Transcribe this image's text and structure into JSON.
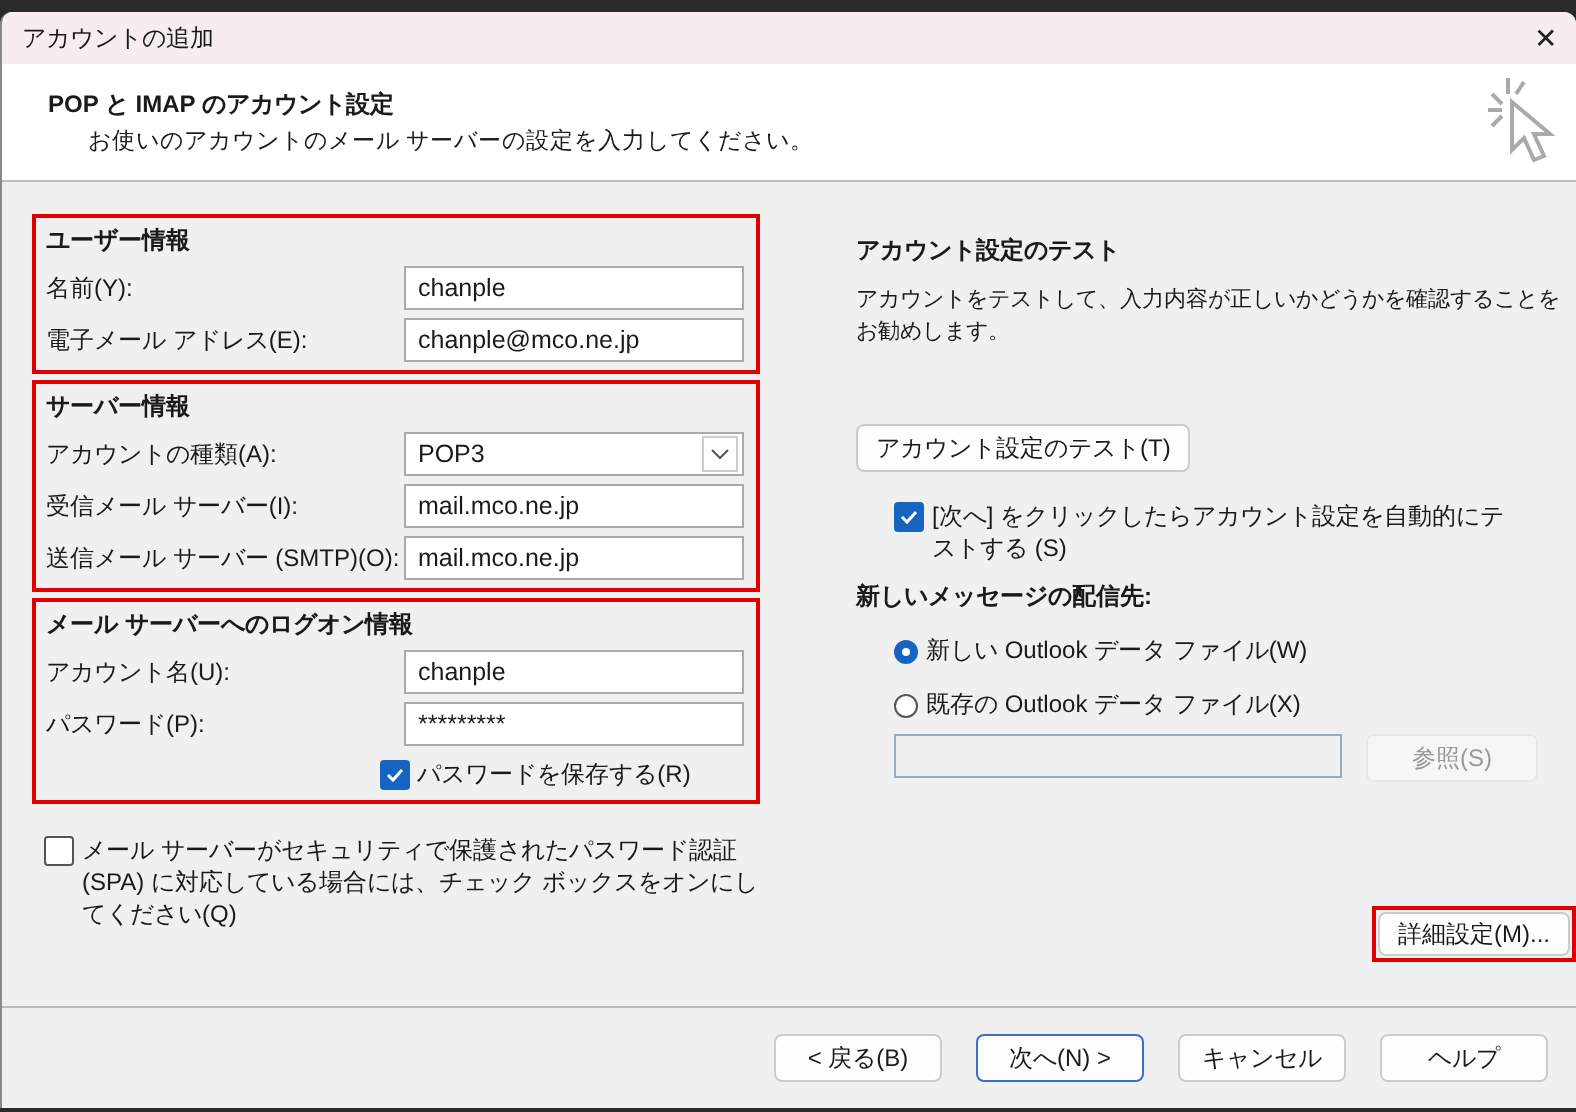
{
  "window": {
    "title": "アカウントの追加",
    "close": "✕"
  },
  "header": {
    "title": "POP と IMAP のアカウント設定",
    "subtitle": "お使いのアカウントのメール サーバーの設定を入力してください。"
  },
  "sections": [
    {
      "title": "ユーザー情報",
      "highlighted": true,
      "fields": [
        {
          "kind": "text",
          "label": "名前(Y):",
          "value": "chanple"
        },
        {
          "kind": "text",
          "label": "電子メール アドレス(E):",
          "value": "chanple@mco.ne.jp"
        }
      ]
    },
    {
      "title": "サーバー情報",
      "highlighted": true,
      "fields": [
        {
          "kind": "select",
          "label": "アカウントの種類(A):",
          "value": "POP3"
        },
        {
          "kind": "text",
          "label": "受信メール サーバー(I):",
          "value": "mail.mco.ne.jp"
        },
        {
          "kind": "text",
          "label": "送信メール サーバー (SMTP)(O):",
          "value": "mail.mco.ne.jp"
        }
      ]
    },
    {
      "title": "メール サーバーへのログオン情報",
      "highlighted": true,
      "fields": [
        {
          "kind": "text",
          "label": "アカウント名(U):",
          "value": "chanple"
        },
        {
          "kind": "text",
          "label": "パスワード(P):",
          "value": "*********"
        }
      ],
      "checkbox": {
        "label": "パスワードを保存する(R)",
        "checked": true
      }
    }
  ],
  "spa": {
    "label": "メール サーバーがセキュリティで保護されたパスワード認証 (SPA) に対応している場合には、チェック ボックスをオンにしてください(Q)",
    "checked": false
  },
  "test": {
    "title": "アカウント設定のテスト",
    "description": "アカウントをテストして、入力内容が正しいかどうかを確認することをお勧めします。",
    "button": "アカウント設定のテスト(T)",
    "auto_test": {
      "label": "[次へ] をクリックしたらアカウント設定を自動的にテストする (S)",
      "checked": true
    }
  },
  "delivery": {
    "title": "新しいメッセージの配信先:",
    "options": [
      {
        "label": "新しい Outlook データ ファイル(W)",
        "selected": true
      },
      {
        "label": "既存の Outlook データ ファイル(X)",
        "selected": false
      }
    ],
    "browse": {
      "label": "参照(S)",
      "disabled": true
    }
  },
  "advanced": {
    "label": "詳細設定(M)...",
    "highlighted": true
  },
  "buttons": [
    {
      "label": "< 戻る(B)",
      "primary": false
    },
    {
      "label": "次へ(N) >",
      "primary": true
    },
    {
      "label": "キャンセル",
      "primary": false
    },
    {
      "label": "ヘルプ",
      "primary": false
    }
  ]
}
